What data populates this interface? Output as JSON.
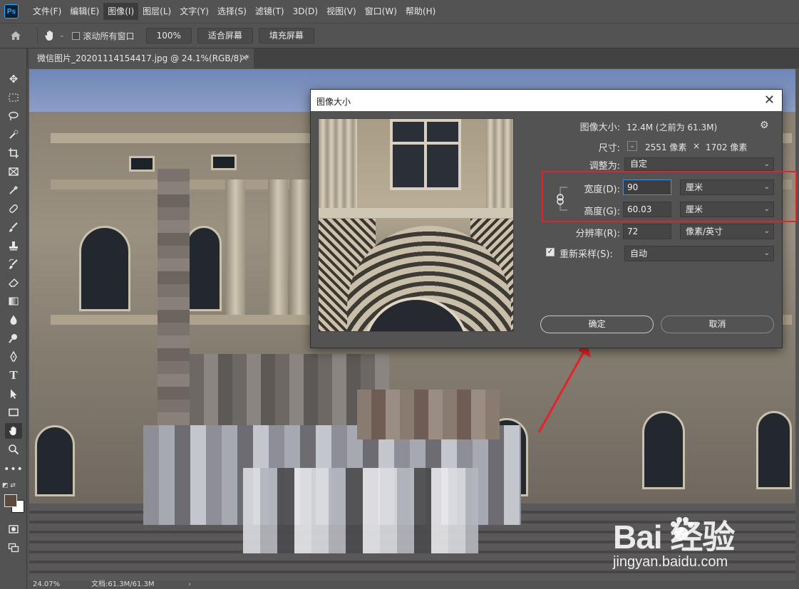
{
  "app": {
    "logo_text": "Ps",
    "menus": [
      "文件(F)",
      "编辑(E)",
      "图像(I)",
      "图层(L)",
      "文字(Y)",
      "选择(S)",
      "滤镜(T)",
      "3D(D)",
      "视图(V)",
      "窗口(W)",
      "帮助(H)"
    ],
    "active_menu": "图像(I)"
  },
  "options_bar": {
    "scroll_all_label": "滚动所有窗口",
    "zoom_100_label": "100%",
    "fit_screen_label": "适合屏幕",
    "fill_screen_label": "填充屏幕"
  },
  "document": {
    "tab_title": "微信图片_20201114154417.jpg @ 24.1%(RGB/8) *",
    "close_glyph": "×"
  },
  "status": {
    "zoom": "24.07%",
    "doc_size": "文档:61.3M/61.3M",
    "nav_glyph": "›"
  },
  "dialog": {
    "title": "图像大小",
    "close_glyph": "✕",
    "image_size_label": "图像大小:",
    "image_size_value": "12.4M (之前为 61.3M)",
    "dimensions_label": "尺寸:",
    "dimensions_width": "2551 像素",
    "dimensions_times": "×",
    "dimensions_height": "1702 像素",
    "fit_to_label": "调整为:",
    "fit_to_value": "自定",
    "width_label": "宽度(D):",
    "width_value": "90",
    "width_unit": "厘米",
    "height_label": "高度(G):",
    "height_value": "60.03",
    "height_unit": "厘米",
    "resolution_label": "分辨率(R):",
    "resolution_value": "72",
    "resolution_unit": "像素/英寸",
    "resample_label": "重新采样(S):",
    "resample_value": "自动",
    "resample_checked": true,
    "ok_label": "确定",
    "cancel_label": "取消"
  },
  "annotation": {
    "highlight_color": "#e3232a"
  },
  "watermark": {
    "logo_text": "Bai  经验",
    "url": "jingyan.baidu.com"
  }
}
